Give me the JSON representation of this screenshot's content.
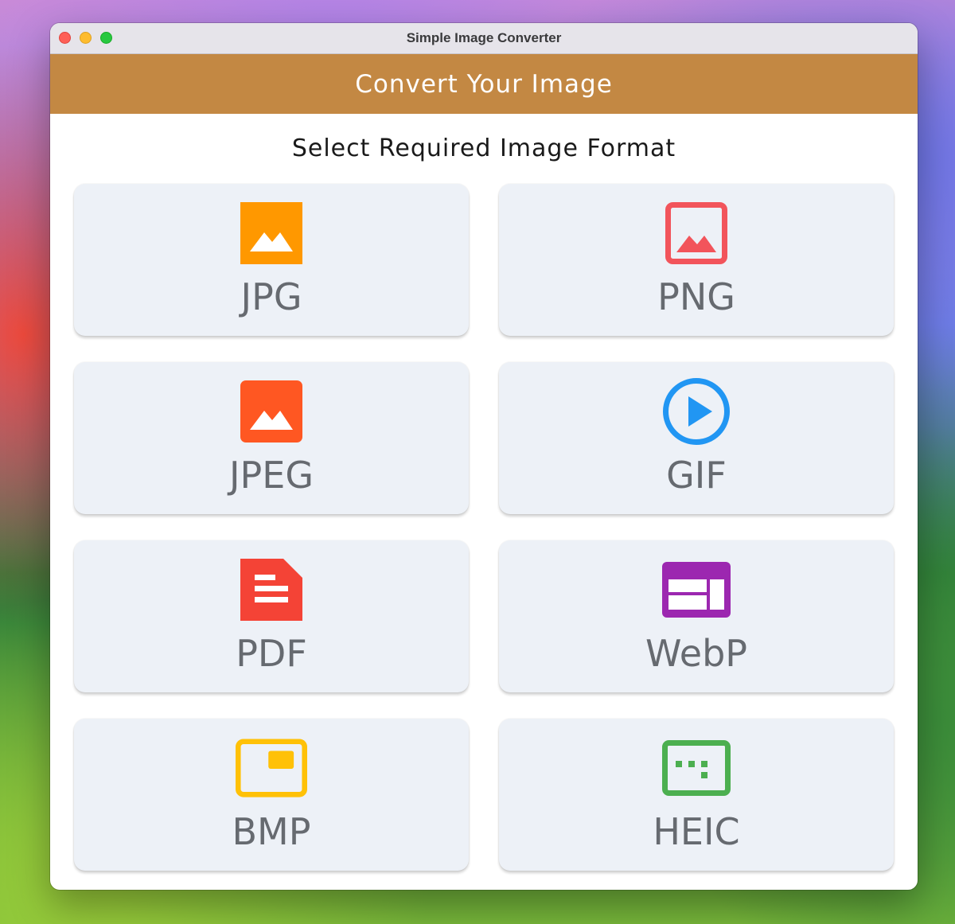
{
  "window": {
    "title": "Simple Image Converter"
  },
  "header": {
    "title": "Convert Your Image"
  },
  "main": {
    "subtitle": "Select Required Image Format",
    "formats": [
      {
        "label": "JPG",
        "icon": "image-icon",
        "color": "#ff9800"
      },
      {
        "label": "PNG",
        "icon": "image-outline-icon",
        "color": "#f2545b"
      },
      {
        "label": "JPEG",
        "icon": "image-icon",
        "color": "#ff5722"
      },
      {
        "label": "GIF",
        "icon": "play-circle-icon",
        "color": "#2196f3"
      },
      {
        "label": "PDF",
        "icon": "document-icon",
        "color": "#f44336"
      },
      {
        "label": "WebP",
        "icon": "web-layout-icon",
        "color": "#9c27b0"
      },
      {
        "label": "BMP",
        "icon": "picture-in-picture-icon",
        "color": "#ffc107"
      },
      {
        "label": "HEIC",
        "icon": "dotted-frame-icon",
        "color": "#4caf50"
      }
    ]
  },
  "colors": {
    "header_bg": "#c38843",
    "card_bg": "#edf1f7",
    "label_text": "#666a70"
  }
}
